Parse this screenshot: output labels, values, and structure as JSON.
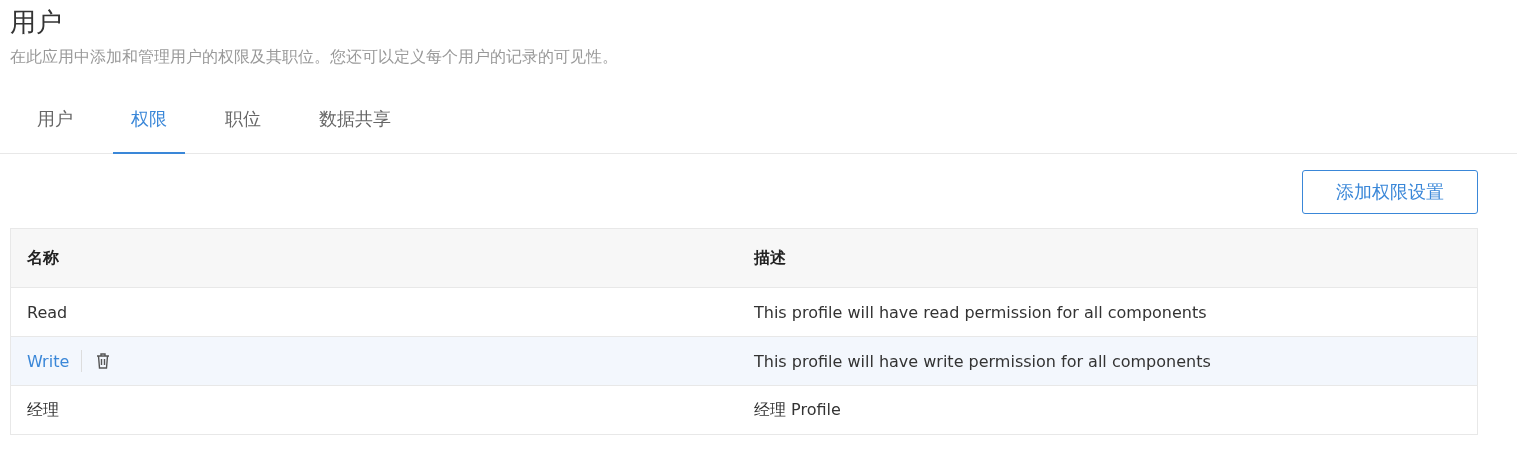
{
  "page": {
    "title": "用户",
    "subtitle": "在此应用中添加和管理用户的权限及其职位。您还可以定义每个用户的记录的可见性。"
  },
  "tabs": [
    {
      "label": "用户",
      "selected": false
    },
    {
      "label": "权限",
      "selected": true
    },
    {
      "label": "职位",
      "selected": false
    },
    {
      "label": "数据共享",
      "selected": false
    }
  ],
  "add_button": "添加权限设置",
  "table": {
    "columns": [
      "名称",
      "描述"
    ],
    "rows": [
      {
        "name": "Read",
        "description": "This profile will have read permission for all components",
        "highlighted": false
      },
      {
        "name": "Write",
        "description": "This profile will have write permission for all components",
        "highlighted": true
      },
      {
        "name": "经理",
        "description": "经理 Profile",
        "highlighted": false
      }
    ]
  }
}
